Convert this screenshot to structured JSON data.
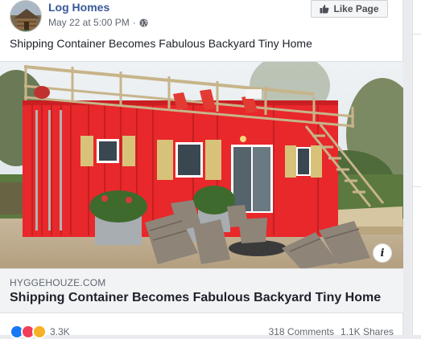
{
  "post": {
    "page_name": "Log Homes",
    "timestamp": "May 22 at 5:00 PM",
    "separator": "·",
    "privacy_icon": "globe-icon",
    "like_page_label": "Like Page",
    "text": "Shipping Container Becomes Fabulous Backyard Tiny Home"
  },
  "link_preview": {
    "domain": "HYGGEHOUZE.COM",
    "title": "Shipping Container Becomes Fabulous Backyard Tiny Home",
    "info_label": "i"
  },
  "stats": {
    "reactions": [
      "like",
      "love",
      "wow"
    ],
    "reaction_count": "3.3K",
    "comments": "318 Comments",
    "shares": "1.1K Shares"
  },
  "colors": {
    "link_blue": "#385898",
    "container_red": "#e8282b",
    "deck_wood": "#c7b48a"
  }
}
